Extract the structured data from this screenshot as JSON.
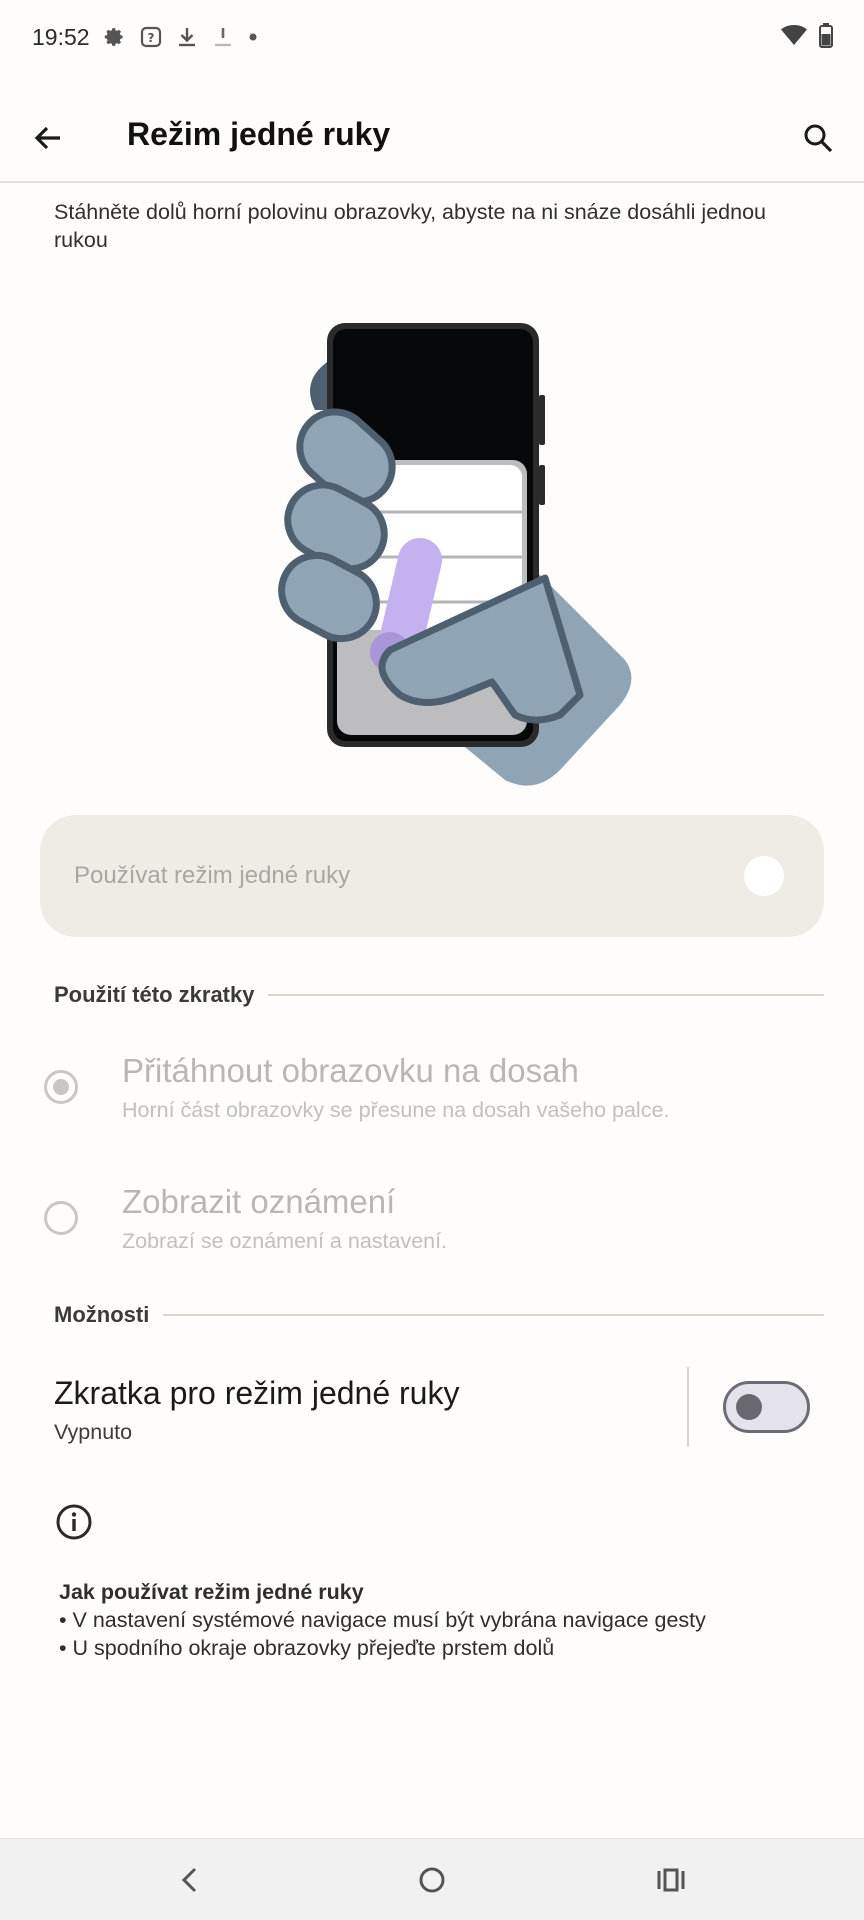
{
  "status_bar": {
    "time": "19:52",
    "left_icons": [
      "settings-gear-icon",
      "help-box-icon",
      "download-icon",
      "download-faded-icon",
      "dot-icon"
    ],
    "right_icons": [
      "wifi-icon",
      "battery-icon"
    ]
  },
  "app_bar": {
    "title": "Režim jedné ruky",
    "back_icon": "arrow-left-icon",
    "search_icon": "search-icon"
  },
  "description": "Stáhněte dolů horní polovinu obrazovky, abyste na ni snáze dosáhli jednou rukou",
  "master_switch": {
    "label": "Používat režim jedné ruky",
    "state": "off"
  },
  "shortcut_section": {
    "title": "Použití této zkratky",
    "options": [
      {
        "title": "Přitáhnout obrazovku na dosah",
        "subtitle": "Horní část obrazovky se přesune na dosah vašeho palce.",
        "selected": true
      },
      {
        "title": "Zobrazit oznámení",
        "subtitle": "Zobrazí se oznámení a nastavení.",
        "selected": false
      }
    ]
  },
  "options_section": {
    "title": "Možnosti",
    "shortcut": {
      "title": "Zkratka pro režim jedné ruky",
      "status": "Vypnuto",
      "state": "off"
    }
  },
  "info": {
    "icon": "info-icon",
    "heading": "Jak používat režim jedné ruky",
    "items": [
      "• V nastavení systémové navigace musí být vybrána navigace gesty",
      "• U spodního okraje obrazovky přejeďte prstem dolů"
    ]
  },
  "nav_bar": {
    "icons": [
      "nav-back-icon",
      "nav-home-icon",
      "nav-recents-icon"
    ]
  },
  "colors": {
    "background": "#fefdfb",
    "switch_container": "#efece6",
    "disabled_text": "#b9b7b3",
    "hand": "#8fa4b4",
    "phone_frame": "#2b2b2b",
    "accent_stroke": "#c4b1f0"
  }
}
